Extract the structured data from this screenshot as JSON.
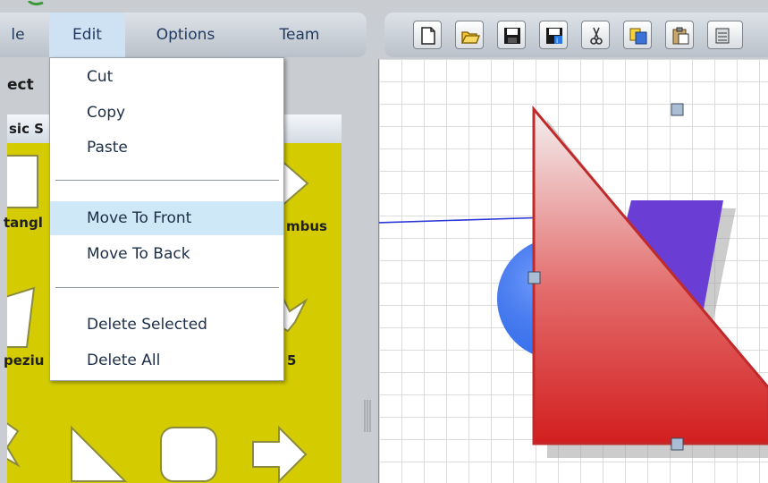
{
  "menubar": {
    "items": [
      {
        "label": "le"
      },
      {
        "label": "Edit"
      },
      {
        "label": "Options"
      },
      {
        "label": "Team"
      }
    ]
  },
  "toolbar": {
    "buttons": [
      "new-file-icon",
      "open-folder-icon",
      "save-icon",
      "save-as-icon",
      "cut-icon",
      "copy-icon",
      "paste-icon"
    ]
  },
  "left_panel": {
    "header": "ect",
    "tab_label": "sic S",
    "shape_labels": [
      "tangl",
      "mbus",
      "peziu",
      "5"
    ]
  },
  "edit_menu": {
    "cut": "Cut",
    "copy": "Copy",
    "paste": "Paste",
    "move_to_front": "Move To Front",
    "move_to_back": "Move To Back",
    "delete_selected": "Delete Selected",
    "delete_all": "Delete All"
  },
  "colors": {
    "shapes_bg": "#d4cc00",
    "triangle": "#d42a2a",
    "trapezoid": "#6a3ed4",
    "circle": "#3b74f0",
    "connector": "#2a36d8",
    "menu_hover": "#cfe8f8"
  }
}
